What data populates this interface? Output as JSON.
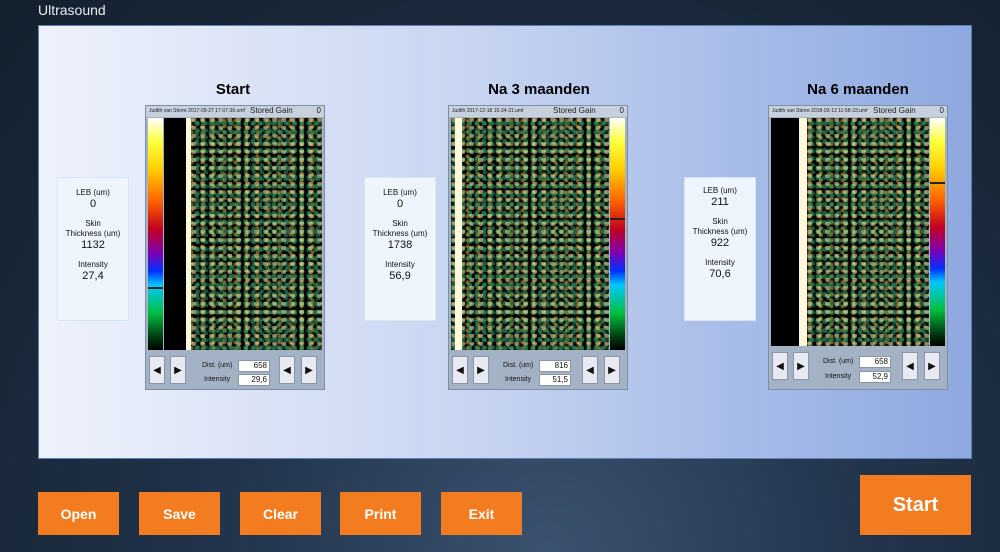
{
  "app": {
    "title": "Ultrasound"
  },
  "labels": {
    "leb": "LEB (um)",
    "skin": "Skin",
    "thickness": "Thickness (um)",
    "intensity": "Intensity",
    "dist": "Dist. (um)",
    "intensity_small": "Intensity",
    "stored_gain": "Stored Gain"
  },
  "series": [
    {
      "title": "Start",
      "file": "Judith van Sterre 2017-09-27 17-07-30.umf",
      "stored_gain_value": "0",
      "leb": "0",
      "skin_thickness": "1132",
      "intensity": "27,4",
      "dist": "658",
      "intensity_readout": "29,6",
      "colorbar_marker_fraction": 0.73
    },
    {
      "title": "Na 3 maanden",
      "file": "Judith 2017-12-18 15-34-31.umf",
      "stored_gain_value": "0",
      "leb": "0",
      "skin_thickness": "1738",
      "intensity": "56,9",
      "dist": "816",
      "intensity_readout": "51,5",
      "colorbar_marker_fraction": 0.43
    },
    {
      "title": "Na 6 maanden",
      "file": "Judith van Sterre 2018-03-13 11-58-33.umf",
      "stored_gain_value": "0",
      "leb": "211",
      "skin_thickness": "922",
      "intensity": "70,6",
      "dist": "658",
      "intensity_readout": "52,9",
      "colorbar_marker_fraction": 0.28
    }
  ],
  "icons": {
    "prev": "left-arrow-icon",
    "next": "right-arrow-icon"
  },
  "buttons": {
    "open": "Open",
    "save": "Save",
    "clear": "Clear",
    "print": "Print",
    "exit": "Exit",
    "start": "Start"
  },
  "colors": {
    "accent": "#f47c20",
    "panel": "#c9d6f2"
  }
}
